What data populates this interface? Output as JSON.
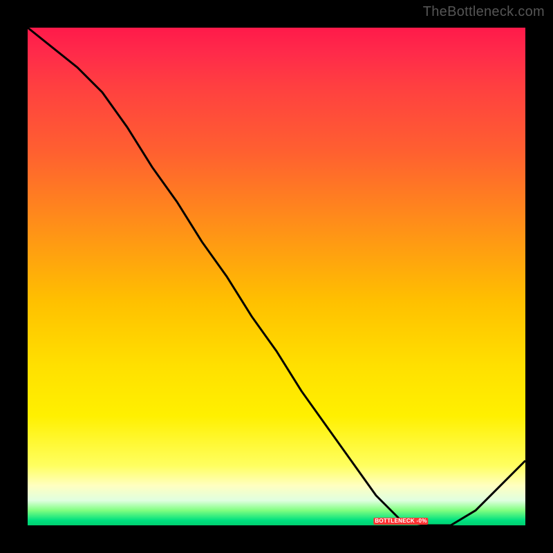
{
  "watermark": "TheBottleneck.com",
  "badge_text": "BOTTLENECK -0%",
  "chart_data": {
    "type": "line",
    "title": "",
    "xlabel": "",
    "ylabel": "",
    "xlim": [
      0,
      100
    ],
    "ylim": [
      0,
      100
    ],
    "x": [
      0,
      5,
      10,
      15,
      20,
      25,
      30,
      35,
      40,
      45,
      50,
      55,
      60,
      65,
      70,
      75,
      80,
      85,
      90,
      95,
      100
    ],
    "values": [
      100,
      96,
      92,
      87,
      80,
      72,
      65,
      57,
      50,
      42,
      35,
      27,
      20,
      13,
      6,
      1,
      0,
      0,
      3,
      8,
      13
    ],
    "gradient_colors": {
      "top": "#ff1a4a",
      "mid_high": "#ff8020",
      "mid": "#ffe000",
      "mid_low": "#ffffc0",
      "bottom": "#00d070"
    },
    "curve_color": "#000000",
    "min_point_x_pct": 82
  }
}
